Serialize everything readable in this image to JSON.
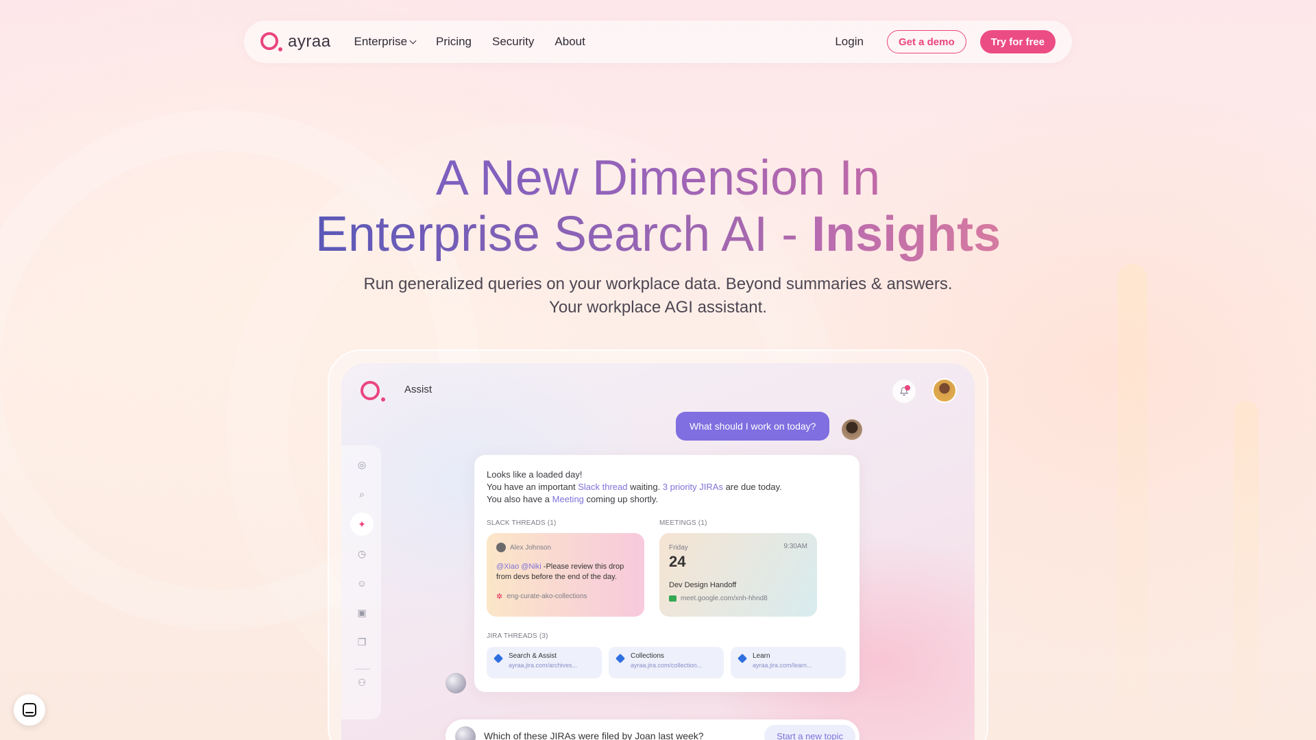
{
  "brand": {
    "name": "ayraa"
  },
  "nav": {
    "items": [
      {
        "label": "Enterprise",
        "has_dropdown": true
      },
      {
        "label": "Pricing"
      },
      {
        "label": "Security"
      },
      {
        "label": "About"
      }
    ],
    "login_label": "Login",
    "demo_label": "Get a demo",
    "try_label": "Try for free"
  },
  "hero": {
    "title_line1": "A New Dimension In",
    "title_line2_prefix": "Enterprise Search AI - ",
    "title_line2_highlight": "Insights",
    "subtitle_line1": "Run generalized queries on your workplace data. Beyond summaries & answers.",
    "subtitle_line2": "Your workplace AGI assistant."
  },
  "app": {
    "title": "Assist",
    "user_message": "What should I work on today?",
    "answer": {
      "line1": "Looks like a loaded day!",
      "line2_a": "You have an important ",
      "line2_link1": "Slack thread",
      "line2_b": " waiting. ",
      "line2_link2": "3 priority JIRAs",
      "line2_c": " are due today.",
      "line3_a": "You also have a ",
      "line3_link": "Meeting",
      "line3_b": " coming up shortly."
    },
    "slack": {
      "section_label": "SLACK THREADS (1)",
      "author": "Alex Johnson",
      "mention": "@Xiao @Niki",
      "message": " -Please review this drop from devs before the end of the day.",
      "channel": "eng-curate-ako-collections"
    },
    "meeting": {
      "section_label": "MEETINGS (1)",
      "day": "Friday",
      "date": "24",
      "time": "9:30AM",
      "title": "Dev Design Handoff",
      "link": "meet.google.com/xnh-hhnd8"
    },
    "jira": {
      "section_label": "JIRA THREADS (3)",
      "items": [
        {
          "title": "Search & Assist",
          "url": "ayraa.jira.com/archives..."
        },
        {
          "title": "Collections",
          "url": "ayraa.jira.com/collection..."
        },
        {
          "title": "Learn",
          "url": "ayraa.jira.com/learn..."
        }
      ]
    },
    "input": {
      "text": "Which of these JIRAs were filed by Joan last week?",
      "new_topic_label": "Start a new topic"
    }
  },
  "colors": {
    "accent": "#e9457f",
    "purple": "#7f6fe0"
  }
}
